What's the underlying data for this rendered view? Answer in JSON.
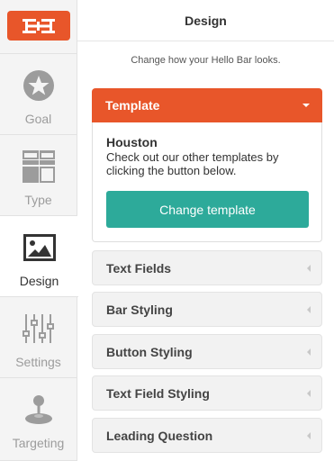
{
  "colors": {
    "accent": "#e8562a",
    "teal": "#2daa9a",
    "sidebar_bg": "#f4f4f4"
  },
  "sidebar": {
    "logo_icon": "hellobar-logo-icon",
    "items": [
      {
        "label": "Goal",
        "icon": "star-icon",
        "active": false
      },
      {
        "label": "Type",
        "icon": "layout-grid-icon",
        "active": false
      },
      {
        "label": "Design",
        "icon": "image-icon",
        "active": true
      },
      {
        "label": "Settings",
        "icon": "sliders-icon",
        "active": false
      },
      {
        "label": "Targeting",
        "icon": "joystick-icon",
        "active": false
      }
    ]
  },
  "main": {
    "title": "Design",
    "subtitle": "Change how your Hello Bar looks.",
    "template": {
      "header": "Template",
      "name": "Houston",
      "description": "Check out our other templates by clicking the button below.",
      "button": "Change template"
    },
    "sections": [
      {
        "label": "Text Fields"
      },
      {
        "label": "Bar Styling"
      },
      {
        "label": "Button Styling"
      },
      {
        "label": "Text Field Styling"
      },
      {
        "label": "Leading Question"
      }
    ]
  }
}
